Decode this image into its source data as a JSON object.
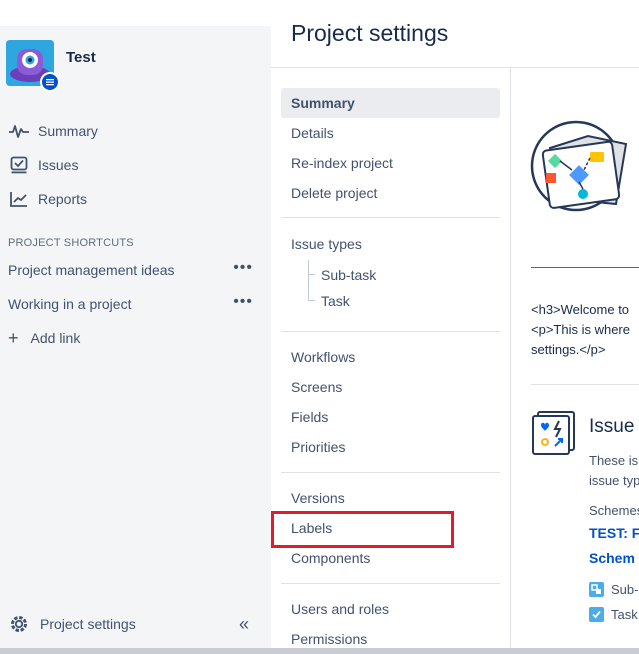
{
  "project": {
    "name": "Test"
  },
  "sidebar": {
    "nav": [
      {
        "label": "Summary",
        "icon": "activity-icon"
      },
      {
        "label": "Issues",
        "icon": "issues-icon"
      },
      {
        "label": "Reports",
        "icon": "reports-icon"
      }
    ],
    "shortcuts_title": "PROJECT SHORTCUTS",
    "shortcuts": [
      {
        "label": "Project management ideas",
        "more": "•••"
      },
      {
        "label": "Working in a project",
        "more": "•••"
      }
    ],
    "add_link": {
      "icon": "+",
      "label": "Add link"
    },
    "footer": {
      "label": "Project settings",
      "collapse": "«"
    }
  },
  "page": {
    "title": "Project settings"
  },
  "settings_nav": {
    "group1": [
      "Summary",
      "Details",
      "Re-index project",
      "Delete project"
    ],
    "group2": {
      "label": "Issue types",
      "sub": [
        "Sub-task",
        "Task"
      ]
    },
    "group3": [
      "Workflows",
      "Screens",
      "Fields",
      "Priorities"
    ],
    "group4": [
      "Versions",
      "Labels",
      "Components"
    ],
    "group5": [
      "Users and roles",
      "Permissions"
    ],
    "active": "Summary",
    "highlighted": "Labels"
  },
  "content": {
    "code_lines": [
      "<h3>Welcome to",
      "<p>This is where",
      "settings.</p>"
    ],
    "issue_section": {
      "heading": "Issue",
      "desc_lines": [
        "These is",
        "issue typ"
      ],
      "scheme_label": "Schemes",
      "scheme_links": [
        "TEST: F",
        "Schem"
      ],
      "types": [
        {
          "label": "Sub-",
          "color": "#4bade8"
        },
        {
          "label": "Task",
          "color": "#4bade8"
        }
      ]
    }
  },
  "colors": {
    "accent": "#0052cc",
    "highlight": "#e01d2d",
    "sidebar_bg": "#f4f5f7"
  }
}
